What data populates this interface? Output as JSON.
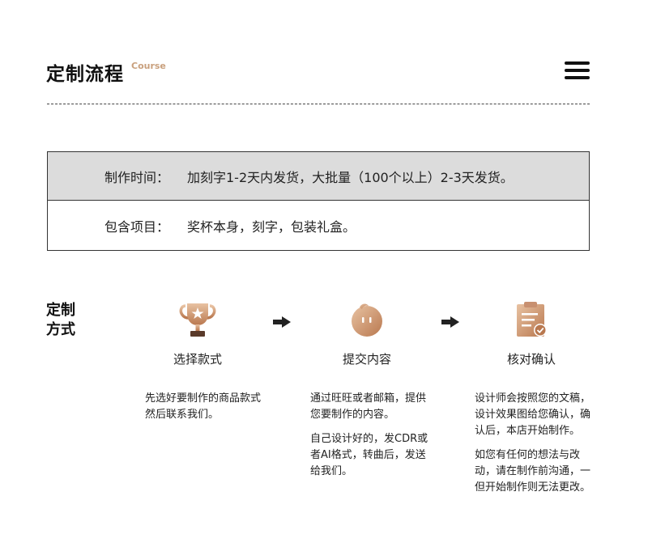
{
  "header": {
    "title": "定制流程",
    "subtitle": "Course"
  },
  "info": {
    "rows": [
      {
        "label": "制作时间：",
        "value": "加刻字1-2天内发货，大批量（100个以上）2-3天发货。"
      },
      {
        "label": "包含项目：",
        "value": "奖杯本身，刻字，包装礼盒。"
      }
    ]
  },
  "method": {
    "label_line1": "定制",
    "label_line2": "方式",
    "steps": [
      {
        "icon": "trophy-icon",
        "title": "选择款式",
        "paragraphs": [
          "先选好要制作的商品款式然后联系我们。"
        ]
      },
      {
        "icon": "chat-mascot-icon",
        "title": "提交内容",
        "paragraphs": [
          "通过旺旺或者邮箱，提供您要制作的内容。",
          "自己设计好的，发CDR或者AI格式，转曲后，发送给我们。"
        ]
      },
      {
        "icon": "clipboard-check-icon",
        "title": "核对确认",
        "paragraphs": [
          "设计师会按照您的文稿，设计效果图给您确认，确认后，本店开始制作。",
          "如您有任何的想法与改动，请在制作前沟通，一但开始制作则无法更改。"
        ]
      }
    ]
  },
  "colors": {
    "accent": "#c9a07d",
    "icon_gradient_light": "#e8c2a2",
    "icon_gradient_dark": "#b9784f",
    "row_bg": "#dcdcdc"
  }
}
